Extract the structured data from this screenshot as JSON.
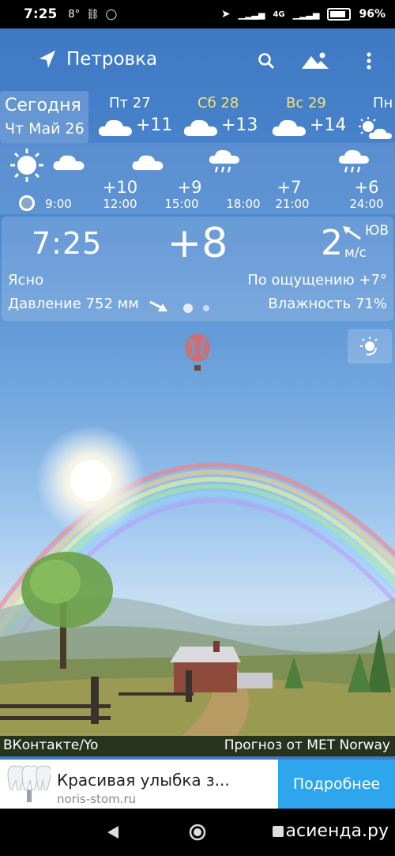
{
  "status_bar": {
    "time": "7:25",
    "notif_temp": "8°",
    "network": "4G",
    "battery": "96%"
  },
  "header": {
    "location": "Петровка"
  },
  "today": {
    "label": "Сегодня",
    "date": "Чт Май 26"
  },
  "days": [
    {
      "name": "Пт 27",
      "temp": "+11",
      "icon": "cloud-icon",
      "highlight": false
    },
    {
      "name": "Сб 28",
      "temp": "+13",
      "icon": "cloud-icon",
      "highlight": true
    },
    {
      "name": "Вс 29",
      "temp": "+14",
      "icon": "cloud-icon",
      "highlight": true
    },
    {
      "name": "Пн",
      "temp": "",
      "icon": "sun-cloud-icon",
      "highlight": false
    }
  ],
  "hourly": [
    {
      "time": "9:00",
      "temp": "",
      "icon": "sun-icon"
    },
    {
      "time": "12:00",
      "temp": "+10",
      "icon": "cloud-icon"
    },
    {
      "time": "15:00",
      "temp": "+9",
      "icon": "cloud-icon"
    },
    {
      "time": "18:00",
      "temp": "",
      "icon": "rain-icon"
    },
    {
      "time": "21:00",
      "temp": "+7",
      "icon": ""
    },
    {
      "time": "24:00",
      "temp": "+6",
      "icon": "rain-icon"
    }
  ],
  "current": {
    "time": "7:25",
    "temp": "+8",
    "wind_speed": "2",
    "wind_dir": "ЮВ",
    "wind_unit": "м/с",
    "condition": "Ясно",
    "feels_like": "По ощущению +7°",
    "pressure": "Давление 752 мм",
    "humidity": "Влажность 71%"
  },
  "credits": {
    "left": "ВКонтакте/Yo",
    "right": "Прогноз от MET Norway"
  },
  "ad": {
    "title": "Красивая улыбка з...",
    "url": "noris-stom.ru",
    "cta": "Подробнее"
  },
  "watermark": "асиенда.ру",
  "colors": {
    "sky_top": "#3f79c4",
    "ad_button": "#2ea6ee",
    "highlight_day": "#f6e27a"
  }
}
